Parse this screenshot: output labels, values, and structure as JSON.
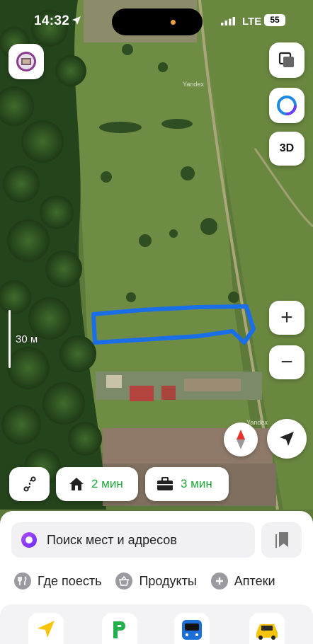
{
  "status_bar": {
    "time": "14:32",
    "network": "LTE",
    "battery": "55"
  },
  "map": {
    "watermark": "Yandex",
    "scale_label": "30 м",
    "buttons": {
      "three_d": "3D",
      "zoom_in": "+",
      "zoom_out": "−"
    }
  },
  "route_chips": {
    "home_time": "2 мин",
    "work_time": "3 мин"
  },
  "search": {
    "placeholder": "Поиск мест и адресов"
  },
  "categories": [
    {
      "label": "Где поесть",
      "icon": "fork-knife-icon"
    },
    {
      "label": "Продукты",
      "icon": "basket-icon"
    },
    {
      "label": "Аптеки",
      "icon": "plus-icon"
    }
  ],
  "tabs": [
    {
      "name": "navigator",
      "icon": "navigator-arrow-icon"
    },
    {
      "name": "parking",
      "icon": "parking-icon"
    },
    {
      "name": "transport",
      "icon": "bus-icon"
    },
    {
      "name": "taxi",
      "icon": "taxi-icon"
    }
  ],
  "colors": {
    "accent_green": "#1fa83a",
    "polygon_blue": "#1a6fe8",
    "navigator_yellow": "#f6c40a",
    "parking_green": "#23b04a",
    "bus_blue": "#1b6fd6"
  }
}
